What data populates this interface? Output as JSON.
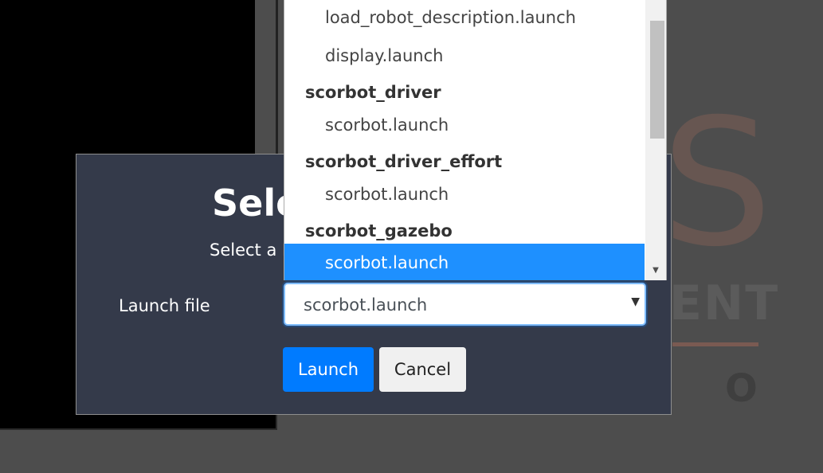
{
  "modal": {
    "title": "Sele",
    "subtitle": "Select a l",
    "field_label": "Launch file",
    "select_value": "scorbot.launch",
    "launch_label": "Launch",
    "cancel_label": "Cancel"
  },
  "dropdown": {
    "items": [
      {
        "type": "option",
        "label": "load_robot_description.launch"
      },
      {
        "type": "option",
        "label": "display.launch"
      },
      {
        "type": "group",
        "label": "scorbot_driver"
      },
      {
        "type": "option",
        "label": "scorbot.launch"
      },
      {
        "type": "group",
        "label": "scorbot_driver_effort"
      },
      {
        "type": "option",
        "label": "scorbot.launch"
      },
      {
        "type": "group",
        "label": "scorbot_gazebo"
      },
      {
        "type": "option",
        "label": "scorbot.launch",
        "selected": true
      }
    ]
  },
  "background": {
    "logo_letter": "S",
    "logo_text": "ENT",
    "logo_small": "O"
  },
  "colors": {
    "accent": "#007bff",
    "selected_option": "#1e90ff",
    "modal_bg": "#343a4a"
  }
}
